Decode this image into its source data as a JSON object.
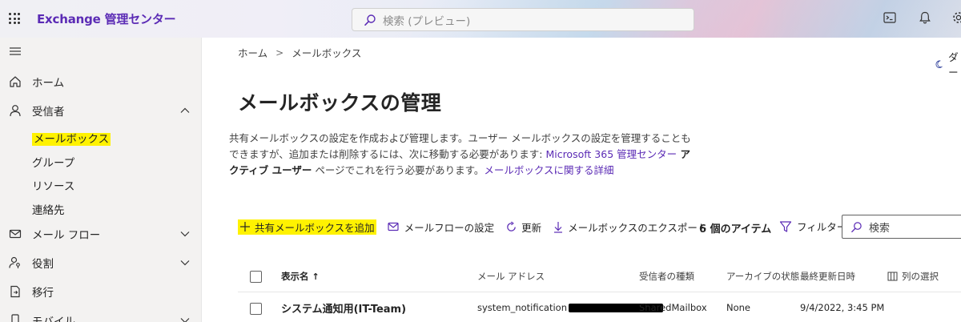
{
  "header": {
    "app_title": "Exchange 管理センター",
    "search_placeholder": "検索 (プレビュー)"
  },
  "nav": {
    "home": "ホーム",
    "recipients": "受信者",
    "recipients_sub": [
      "メールボックス",
      "グループ",
      "リソース",
      "連絡先"
    ],
    "mail_flow": "メール フロー",
    "roles": "役割",
    "migration": "移行",
    "mobile": "モバイル"
  },
  "breadcrumb": {
    "home": "ホーム",
    "current": "メールボックス"
  },
  "dark_mode_label": "ダー",
  "page": {
    "title": "メールボックスの管理",
    "desc_part1": "共有メールボックスの設定を作成および管理します。ユーザー メールボックスの設定を管理することもできますが、追加または削除するには、次に移動する必要があります: ",
    "desc_link1": "Microsoft 365 管理センター",
    "desc_bold": " アクティブ ユーザー",
    "desc_part2": " ページでこれを行う必要があります。",
    "desc_link2": "メールボックスに関する詳細"
  },
  "commands": {
    "add_shared": "共有メールボックスを追加",
    "mail_flow_settings": "メールフローの設定",
    "refresh": "更新",
    "export": "メールボックスのエクスポート"
  },
  "item_count": "6 個のアイテム",
  "filter_label": "フィルター",
  "search_placeholder": "検索",
  "table": {
    "columns": [
      "表示名",
      "メール アドレス",
      "受信者の種類",
      "アーカイブの状態",
      "最終更新日時",
      "列の選択"
    ],
    "sort_indicator": "↑",
    "rows": [
      {
        "display_name": "システム通知用(IT-Team)",
        "email_visible": "system_notification",
        "recipient_type": "SharedMailbox",
        "archive_status": "None",
        "last_modified": "9/4/2022, 3:45 PM"
      }
    ]
  },
  "colors": {
    "accent": "#5b2bb5",
    "highlight": "#fff200",
    "nav_bg": "#f3f2f1"
  }
}
